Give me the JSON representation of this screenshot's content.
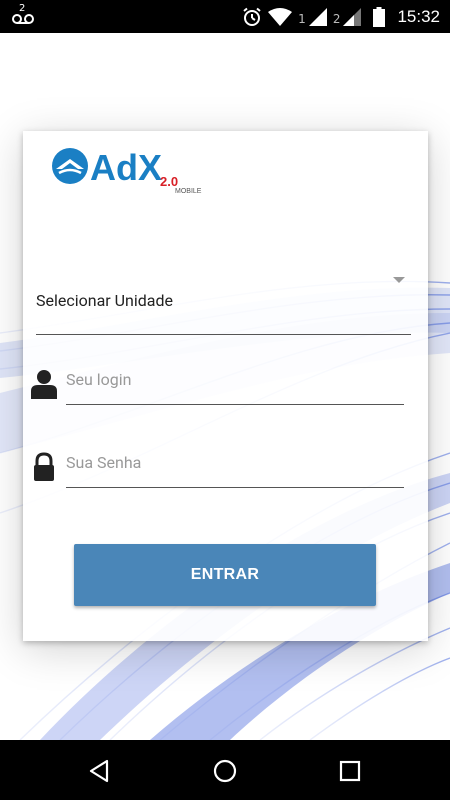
{
  "status_bar": {
    "voicemail_badge": "2",
    "sim1_label": "1",
    "sim2_label": "2",
    "time": "15:32",
    "icons": [
      "voicemail-icon",
      "alarm-icon",
      "wifi-icon",
      "signal-icon",
      "signal-icon",
      "battery-icon"
    ]
  },
  "logo": {
    "brand": "AdX",
    "version": "2.0",
    "sub": "MOBILE"
  },
  "form": {
    "unit_select_label": "Selecionar Unidade",
    "login_placeholder": "Seu login",
    "password_placeholder": "Sua Senha",
    "submit_label": "ENTRAR"
  },
  "colors": {
    "button": "#4a86b8",
    "logo_blue": "#1a7fc4",
    "logo_red": "#d81f26"
  },
  "nav_bar": {
    "icons": [
      "back-icon",
      "home-icon",
      "recents-icon"
    ]
  }
}
